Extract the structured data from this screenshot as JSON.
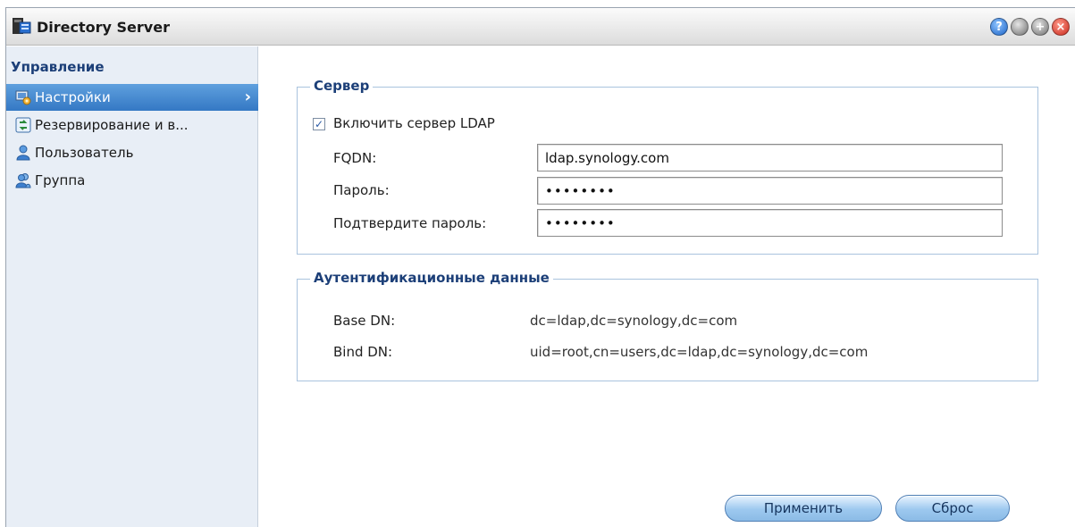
{
  "window": {
    "title": "Directory Server",
    "controls": {
      "help_icon": "help-icon",
      "minimize_icon": "minimize-icon",
      "maximize_icon": "maximize-icon",
      "close_icon": "close-icon",
      "help_glyph": "?",
      "max_glyph": "+",
      "close_glyph": "×"
    }
  },
  "sidebar": {
    "heading": "Управление",
    "items": [
      {
        "label": "Настройки",
        "icon": "settings-icon",
        "active": true
      },
      {
        "label": "Резервирование и в...",
        "icon": "backup-icon",
        "active": false
      },
      {
        "label": "Пользователь",
        "icon": "user-icon",
        "active": false
      },
      {
        "label": "Группа",
        "icon": "group-icon",
        "active": false
      }
    ],
    "chevron": "›"
  },
  "server": {
    "legend": "Сервер",
    "enable_ldap_label": "Включить сервер LDAP",
    "enable_ldap_checked": true,
    "fqdn_label": "FQDN:",
    "fqdn_value": "ldap.synology.com",
    "password_label": "Пароль:",
    "password_value": "••••••••",
    "confirm_label": "Подтвердите пароль:",
    "confirm_value": "••••••••"
  },
  "auth": {
    "legend": "Аутентификационные данные",
    "base_dn_label": "Base DN:",
    "base_dn_value": "dc=ldap,dc=synology,dc=com",
    "bind_dn_label": "Bind DN:",
    "bind_dn_value": "uid=root,cn=users,dc=ldap,dc=synology,dc=com"
  },
  "actions": {
    "apply_label": "Применить",
    "reset_label": "Сброс"
  },
  "colors": {
    "accent": "#3478c4",
    "heading": "#1c3f78",
    "sidebar_bg": "#e8eef6"
  }
}
